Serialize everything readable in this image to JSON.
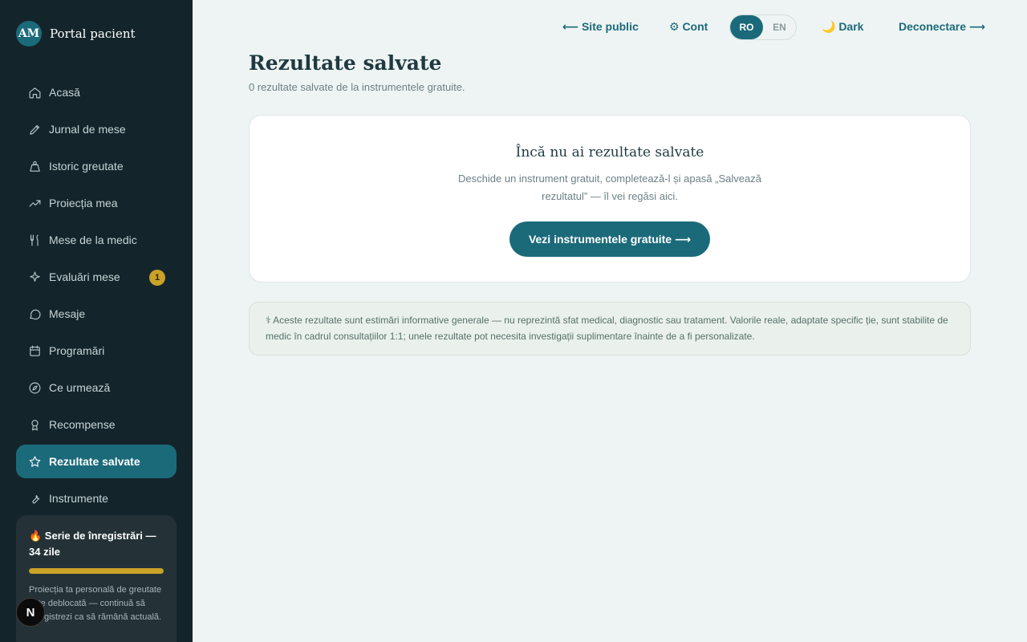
{
  "sidebar": {
    "avatar_initials": "AM",
    "brand": "Portal pacient",
    "items": [
      {
        "label": "Acasă",
        "icon": "home-icon"
      },
      {
        "label": "Jurnal de mese",
        "icon": "pencil-icon"
      },
      {
        "label": "Istoric greutate",
        "icon": "weight-icon"
      },
      {
        "label": "Proiecția mea",
        "icon": "trending-up-icon"
      },
      {
        "label": "Mese de la medic",
        "icon": "utensils-icon"
      },
      {
        "label": "Evaluări mese",
        "icon": "sparkles-icon",
        "badge": "1"
      },
      {
        "label": "Mesaje",
        "icon": "chat-bubble-icon"
      },
      {
        "label": "Programări",
        "icon": "calendar-icon"
      },
      {
        "label": "Ce urmează",
        "icon": "compass-icon"
      },
      {
        "label": "Recompense",
        "icon": "award-icon"
      },
      {
        "label": "Rezultate salvate",
        "icon": "star-icon",
        "active": true
      },
      {
        "label": "Instrumente",
        "icon": "wrench-icon"
      }
    ],
    "streak": {
      "title": "🔥 Serie de înregistrări — 34 zile",
      "progress": 1.0,
      "text": "Proiecția ta personală de greutate este deblocată — continuă să înregistrezi ca să rămână actuală."
    },
    "dev_badge": "N"
  },
  "topbar": {
    "site_public": "⟵ Site public",
    "account": "⚙ Cont",
    "lang_ro": "RO",
    "lang_en": "EN",
    "theme": "🌙 Dark",
    "logout": "Deconectare ⟶"
  },
  "main": {
    "title": "Rezultate salvate",
    "subtitle": "0 rezultate salvate de la instrumentele gratuite.",
    "empty": {
      "title": "Încă nu ai rezultate salvate",
      "text": "Deschide un instrument gratuit, completează-l și apasă „Salvează rezultatul” — îl vei regăsi aici.",
      "cta": "Vezi instrumentele gratuite ⟶"
    },
    "disclaimer": "⚕ Aceste rezultate sunt estimări informative generale — nu reprezintă sfat medical, diagnostic sau tratament. Valorile reale, adaptate specific ție, sunt stabilite de medic în cadrul consultațiilor 1:1; unele rezultate pot necesita investigații suplimentare înainte de a fi personalizate."
  },
  "colors": {
    "accent": "#1b6a7a",
    "sidebar_bg": "#13252b",
    "page_bg": "#eef4f3",
    "badge": "#c9a227"
  }
}
